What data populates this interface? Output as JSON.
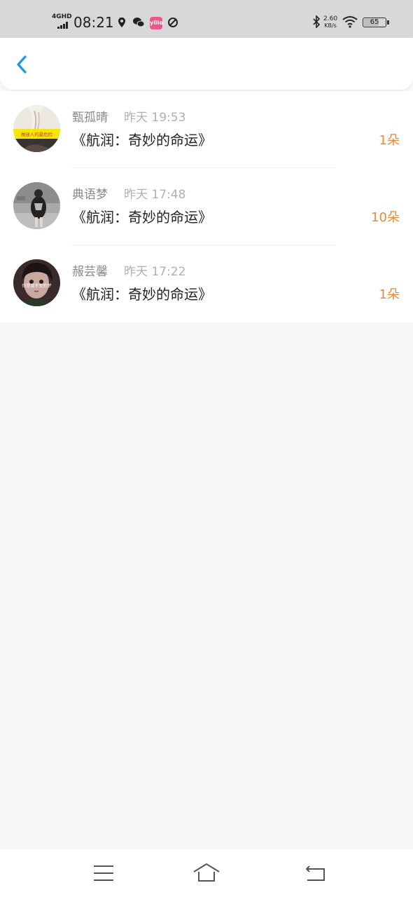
{
  "status_bar": {
    "network": "4GHD",
    "time": "08:21",
    "app_badge": "ylilo",
    "speed_value": "2.60",
    "speed_unit": "KB/s",
    "battery": "65"
  },
  "header": {
    "back_icon": "chevron-left-icon",
    "accent_color": "#1a9be6"
  },
  "gifts": [
    {
      "name": "甄孤晴",
      "time": "昨天 19:53",
      "title": "《航润：奇妙的命运》",
      "count": "1朵"
    },
    {
      "name": "典语梦",
      "time": "昨天 17:48",
      "title": "《航润：奇妙的命运》",
      "count": "10朵"
    },
    {
      "name": "赧芸馨",
      "time": "昨天 17:22",
      "title": "《航润：奇妙的命运》",
      "count": "1朵"
    }
  ],
  "avatar_captions": [
    "做迷人的最危险",
    "你是我不变的梦"
  ],
  "nav": {
    "menu_icon": "menu-icon",
    "home_icon": "home-icon",
    "back_icon": "back-icon"
  },
  "colors": {
    "count": "#e58a3d",
    "name": "#8a8a8a",
    "page_bg": "#f8f6f7"
  }
}
